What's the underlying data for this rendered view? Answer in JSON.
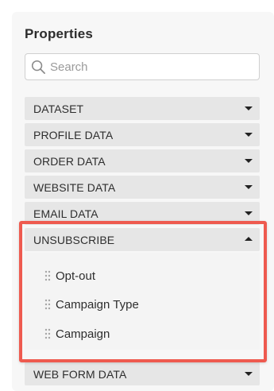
{
  "panel": {
    "title": "Properties"
  },
  "search": {
    "placeholder": "Search",
    "value": ""
  },
  "sections": [
    {
      "label": "DATASET",
      "state": "collapsed"
    },
    {
      "label": "PROFILE DATA",
      "state": "collapsed"
    },
    {
      "label": "ORDER DATA",
      "state": "collapsed"
    },
    {
      "label": "WEBSITE DATA",
      "state": "collapsed"
    },
    {
      "label": "EMAIL DATA",
      "state": "collapsed"
    },
    {
      "label": "UNSUBSCRIBE",
      "state": "expanded",
      "items": [
        {
          "label": "Opt-out"
        },
        {
          "label": "Campaign Type"
        },
        {
          "label": "Campaign"
        }
      ]
    },
    {
      "label": "WEB FORM DATA",
      "state": "collapsed"
    }
  ],
  "icons": {
    "search": "search-icon",
    "collapsed": "caret-down-icon",
    "expanded": "caret-up-icon",
    "drag": "drag-handle-icon"
  },
  "colors": {
    "highlight": "#ee5a4f",
    "panel_bg": "#f7f7f7",
    "section_bg": "#e6e6e6"
  }
}
